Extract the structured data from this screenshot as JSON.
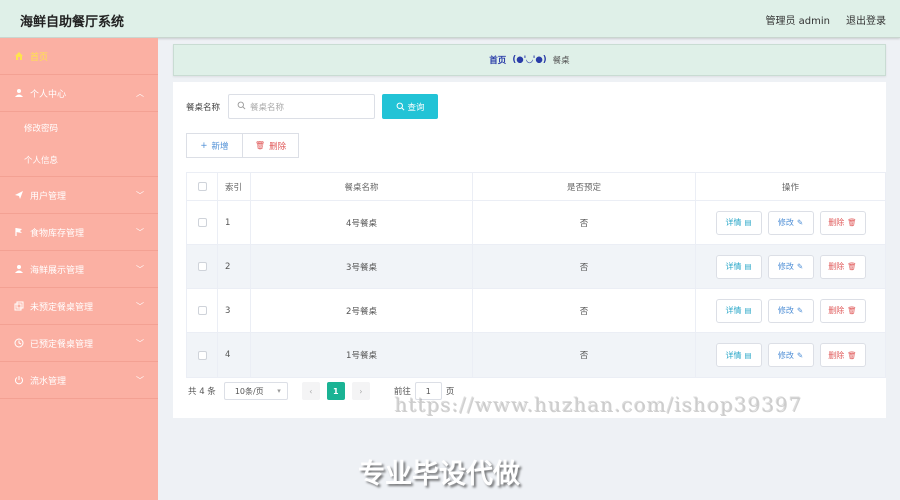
{
  "app": {
    "title": "海鲜自助餐厅系统"
  },
  "topbar": {
    "user": "管理员 admin",
    "logout": "退出登录"
  },
  "sidebar": {
    "items": [
      {
        "label": "首页",
        "icon": "home-icon"
      },
      {
        "label": "个人中心",
        "icon": "user-icon"
      },
      {
        "label": "用户管理",
        "icon": "send-icon"
      },
      {
        "label": "食物库存管理",
        "icon": "flag-icon"
      },
      {
        "label": "海鲜展示管理",
        "icon": "user-icon"
      },
      {
        "label": "未预定餐桌管理",
        "icon": "copy-icon"
      },
      {
        "label": "已预定餐桌管理",
        "icon": "clock-icon"
      },
      {
        "label": "流水管理",
        "icon": "power-icon"
      }
    ],
    "sub_items": [
      "修改密码",
      "个人信息"
    ]
  },
  "breadcrumb": {
    "home": "首页",
    "face": "(●'◡'●)",
    "current": "餐桌"
  },
  "search": {
    "label": "餐桌名称",
    "placeholder": "餐桌名称",
    "button": "查询"
  },
  "actions": {
    "add": "新增",
    "delete": "删除"
  },
  "table": {
    "headers": {
      "index": "索引",
      "name": "餐桌名称",
      "booked": "是否预定",
      "ops": "操作"
    },
    "rows": [
      {
        "index": "1",
        "name": "4号餐桌",
        "booked": "否"
      },
      {
        "index": "2",
        "name": "3号餐桌",
        "booked": "否"
      },
      {
        "index": "3",
        "name": "2号餐桌",
        "booked": "否"
      },
      {
        "index": "4",
        "name": "1号餐桌",
        "booked": "否"
      }
    ],
    "op_labels": {
      "detail": "详情",
      "edit": "修改",
      "remove": "删除"
    }
  },
  "pagination": {
    "total": "共 4 条",
    "page_size": "10条/页",
    "current_page": "1",
    "goto_label": "前往",
    "goto_value": "1",
    "page_unit": "页"
  },
  "watermark": {
    "url": "https://www.huzhan.com/ishop39397",
    "text": "专业毕设代做"
  },
  "colors": {
    "sidebar": "#fbb0a3",
    "topbar": "#dff0e8",
    "accent": "#22c3d6",
    "page_active": "#1ab394"
  }
}
